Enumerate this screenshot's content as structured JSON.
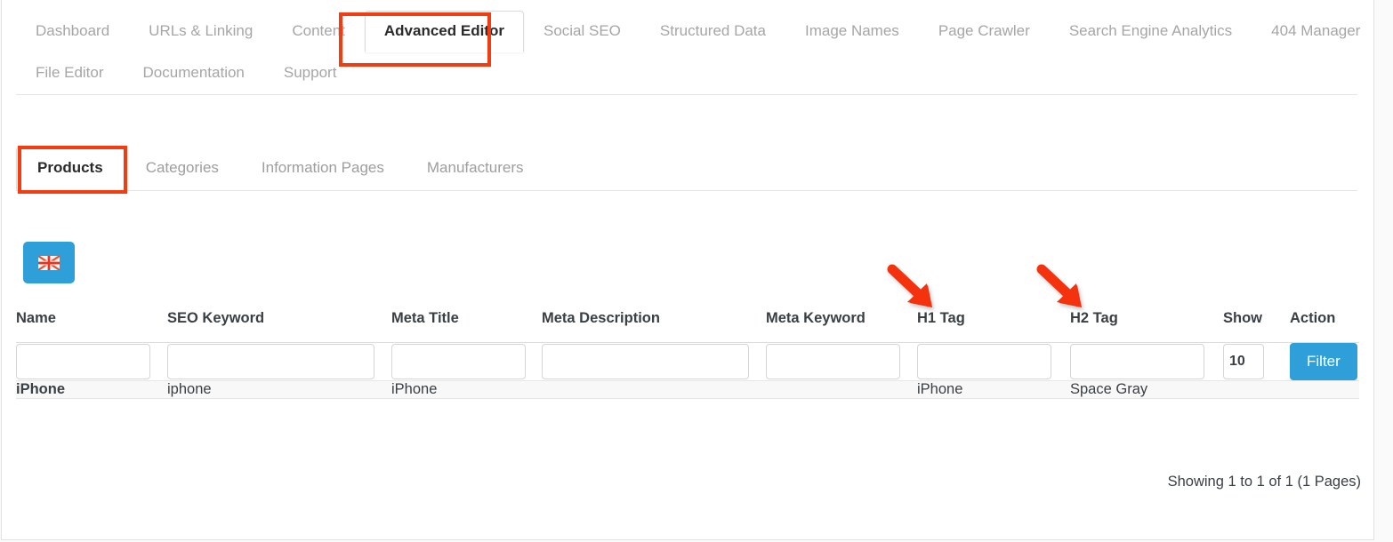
{
  "main_nav": {
    "tabs": [
      {
        "label": "Dashboard",
        "active": false
      },
      {
        "label": "URLs & Linking",
        "active": false
      },
      {
        "label": "Content",
        "active": false
      },
      {
        "label": "Advanced Editor",
        "active": true
      },
      {
        "label": "Social SEO",
        "active": false
      },
      {
        "label": "Structured Data",
        "active": false
      },
      {
        "label": "Image Names",
        "active": false
      },
      {
        "label": "Page Crawler",
        "active": false
      },
      {
        "label": "Search Engine Analytics",
        "active": false
      },
      {
        "label": "404 Manager",
        "active": false
      },
      {
        "label": "File Editor",
        "active": false
      },
      {
        "label": "Documentation",
        "active": false
      },
      {
        "label": "Support",
        "active": false
      }
    ]
  },
  "sub_nav": {
    "tabs": [
      {
        "label": "Products",
        "active": true
      },
      {
        "label": "Categories",
        "active": false
      },
      {
        "label": "Information Pages",
        "active": false
      },
      {
        "label": "Manufacturers",
        "active": false
      }
    ]
  },
  "toolbar": {
    "language_button_icon": "uk-flag-icon"
  },
  "table": {
    "headers": [
      "Name",
      "SEO Keyword",
      "Meta Title",
      "Meta Description",
      "Meta Keyword",
      "H1 Tag",
      "H2 Tag",
      "Show",
      "Action"
    ],
    "filters": {
      "name": "",
      "seo_keyword": "",
      "meta_title": "",
      "meta_description": "",
      "meta_keyword": "",
      "h1_tag": "",
      "h2_tag": "",
      "show_count": "10",
      "filter_button_label": "Filter"
    },
    "rows": [
      {
        "name": "iPhone",
        "seo_keyword": "iphone",
        "meta_title": "iPhone",
        "meta_description": "",
        "meta_keyword": "",
        "h1_tag": "iPhone",
        "h2_tag": "Space Gray",
        "show": "",
        "action": ""
      }
    ]
  },
  "footer": {
    "showing_info": "Showing 1 to 1 of 1 (1 Pages)"
  },
  "annotations": {
    "arrow_h1": "red-arrow-icon",
    "arrow_h2": "red-arrow-icon",
    "highlight_main_tab": "Advanced Editor",
    "highlight_sub_tab": "Products"
  },
  "colors": {
    "accent_blue": "#2e9fd8",
    "annotation_red": "#f23d12",
    "text_dark": "#3a3f44",
    "text_muted": "#a6a6a6"
  }
}
